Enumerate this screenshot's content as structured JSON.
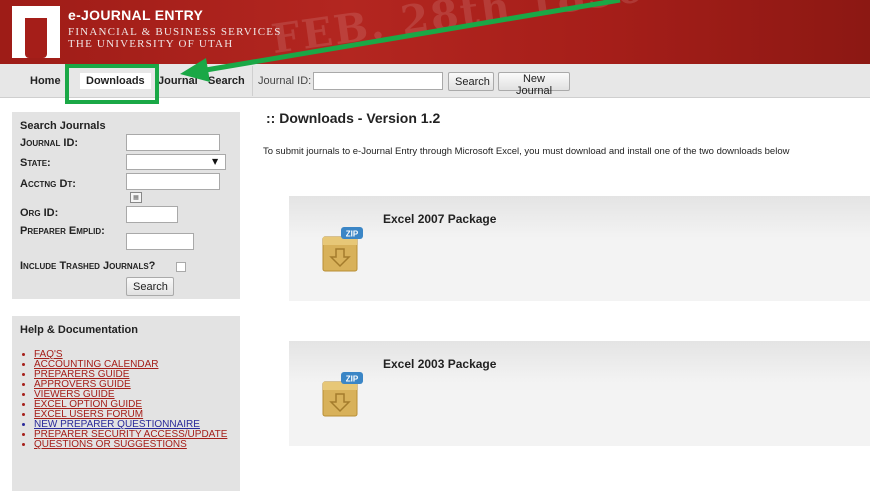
{
  "header": {
    "title": "e-JOURNAL ENTRY",
    "subtitle_line1": "FINANCIAL & BUSINESS SERVICES",
    "subtitle_line2": "THE UNIVERSITY OF UTAH",
    "watermark_1": "FEB. 28th 1850"
  },
  "nav": {
    "tabs": [
      {
        "label": "Home"
      },
      {
        "label": "Downloads",
        "active": true
      },
      {
        "label": "Journal"
      },
      {
        "label": "Search"
      }
    ],
    "journal_id_label": "Journal ID:",
    "journal_id_value": "",
    "search_button": "Search",
    "new_journal_button": "New Journal"
  },
  "sidebar": {
    "search_panel": {
      "title": "Search Journals",
      "journal_id_label": "Journal ID:",
      "state_label": "State:",
      "acctng_dt_label": "Acctng Dt:",
      "org_id_label": "Org ID:",
      "preparer_emplid_label": "Preparer Emplid:",
      "include_trashed_label": "Include Trashed Journals?",
      "search_button": "Search"
    },
    "help_panel": {
      "title": "Help & Documentation",
      "links": [
        "FAQ'S",
        "ACCOUNTING CALENDAR",
        "PREPARERS GUIDE",
        "APPROVERS GUIDE",
        "VIEWERS GUIDE",
        "EXCEL OPTION GUIDE",
        "EXCEL USERS FORUM",
        "NEW PREPARER QUESTIONNAIRE",
        "PREPARER SECURITY ACCESS/UPDATE",
        "QUESTIONS OR SUGGESTIONS"
      ]
    }
  },
  "main": {
    "title": ":: Downloads - Version 1.2",
    "intro": "To submit journals to e-Journal Entry through Microsoft Excel, you must download and install one of the two downloads below",
    "packages": [
      {
        "name": "Excel 2007 Package",
        "icon": "zip-icon"
      },
      {
        "name": "Excel 2003 Package",
        "icon": "zip-icon"
      }
    ]
  },
  "colors": {
    "brand_red": "#a51e19",
    "highlight_green": "#1aa846",
    "link_red": "#a51e19",
    "link_blue": "#2a2a9a"
  }
}
